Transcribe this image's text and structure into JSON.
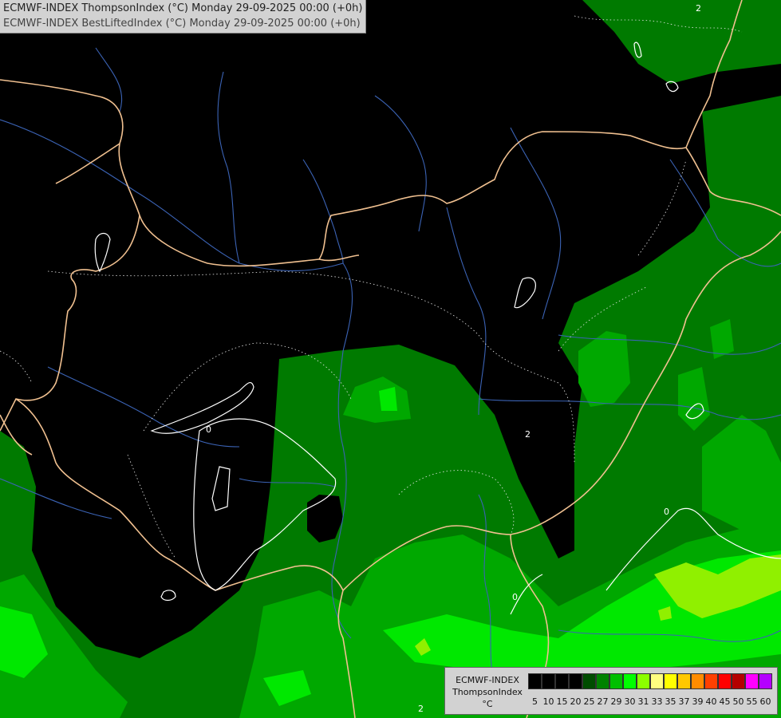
{
  "header": {
    "line1": "ECMWF-INDEX ThompsonIndex (°C) Monday 29-09-2025 00:00 (+0h)",
    "line2": "ECMWF-INDEX BestLiftedIndex (°C) Monday 29-09-2025 00:00 (+0h)"
  },
  "contour_labels": {
    "zero_west": "0",
    "zero_east": "0",
    "zero_south": "0",
    "two_east": "2",
    "two_north": "2",
    "two_south": "2"
  },
  "legend": {
    "title1": "ECMWF-INDEX",
    "title2": "ThompsonIndex",
    "unit": "°C",
    "colors": [
      "#000000",
      "#000000",
      "#000000",
      "#000000",
      "#004c00",
      "#008200",
      "#00bf00",
      "#00ff00",
      "#8cff00",
      "#ffff80",
      "#ffff00",
      "#ffc800",
      "#ff8c00",
      "#ff4000",
      "#ff0000",
      "#b40000",
      "#ff00ff",
      "#b400ff",
      "#7800ff",
      "#3c00ff",
      "#0000ff"
    ],
    "ticks": [
      "5",
      "10",
      "15",
      "20",
      "25",
      "27",
      "29",
      "30",
      "31",
      "33",
      "35",
      "37",
      "39",
      "40",
      "45",
      "50",
      "55",
      "60"
    ]
  }
}
